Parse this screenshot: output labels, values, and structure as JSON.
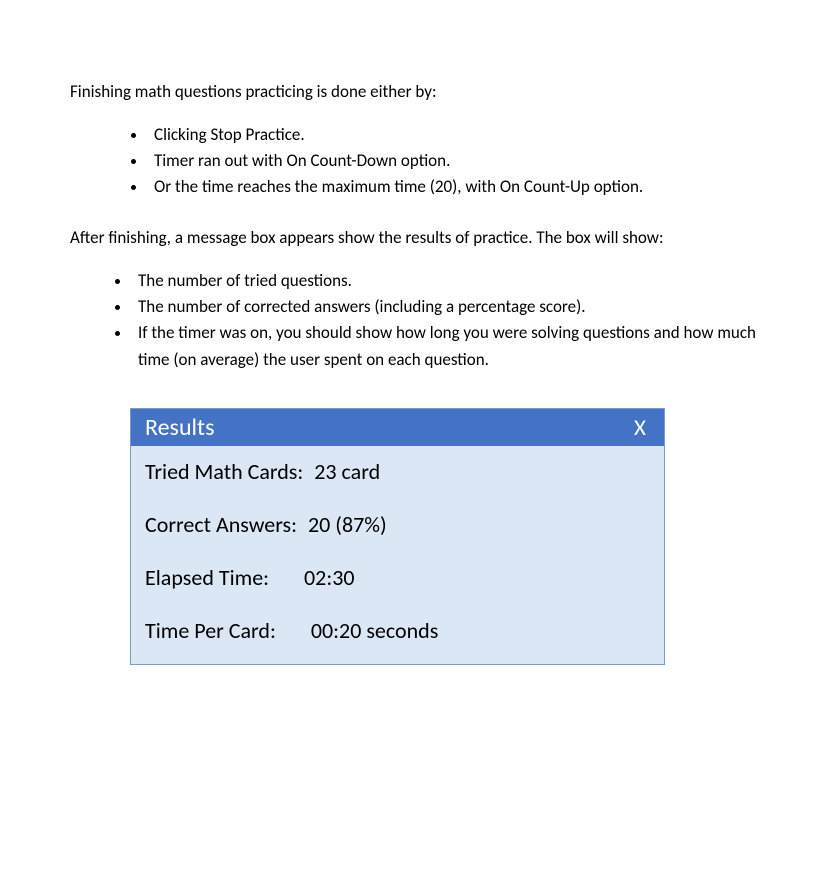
{
  "intro": "Finishing math questions practicing is done either by:",
  "list1": [
    "Clicking Stop Practice.",
    "Timer ran out with On Count-Down option.",
    "Or the time reaches the maximum time (20), with On Count-Up option."
  ],
  "para2": "After finishing, a message box appears show the results of practice. The box will show:",
  "list2": [
    "The number of tried questions.",
    "The number of corrected answers (including a percentage score).",
    "If the timer was on, you should show how long you were solving questions and how much time (on average) the user spent on each question."
  ],
  "results": {
    "title": "Results",
    "close": "X",
    "rows": {
      "tried": {
        "label": "Tried Math Cards:",
        "value": "23 card"
      },
      "correct": {
        "label": "Correct Answers:",
        "value": "20 (87%)"
      },
      "elapsed": {
        "label": "Elapsed Time:",
        "value": "02:30"
      },
      "percard": {
        "label": "Time Per Card:",
        "value": "00:20 seconds"
      }
    }
  }
}
